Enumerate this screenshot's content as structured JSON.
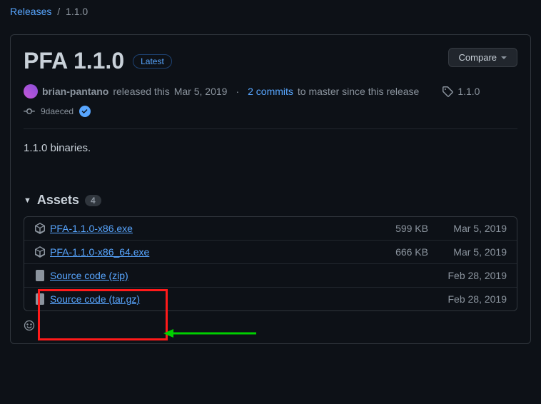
{
  "breadcrumb": {
    "parent": "Releases",
    "current": "1.1.0"
  },
  "release": {
    "title": "PFA 1.1.0",
    "latest_label": "Latest",
    "compare_label": "Compare",
    "author": "brian-pantano",
    "released_text": "released this",
    "release_date": "Mar 5, 2019",
    "commits_count": "2 commits",
    "commits_suffix": "to master since this release",
    "tag": "1.1.0",
    "commit": "9daeced",
    "body": "1.1.0 binaries.",
    "assets_label": "Assets",
    "assets_count": "4",
    "assets": [
      {
        "name": "PFA-1.1.0-x86.exe",
        "size": "599 KB",
        "date": "Mar 5, 2019",
        "type": "package"
      },
      {
        "name": "PFA-1.1.0-x86_64.exe",
        "size": "666 KB",
        "date": "Mar 5, 2019",
        "type": "package"
      },
      {
        "name": "Source code (zip)",
        "size": "",
        "date": "Feb 28, 2019",
        "type": "zip"
      },
      {
        "name": "Source code (tar.gz)",
        "size": "",
        "date": "Feb 28, 2019",
        "type": "zip"
      }
    ]
  }
}
